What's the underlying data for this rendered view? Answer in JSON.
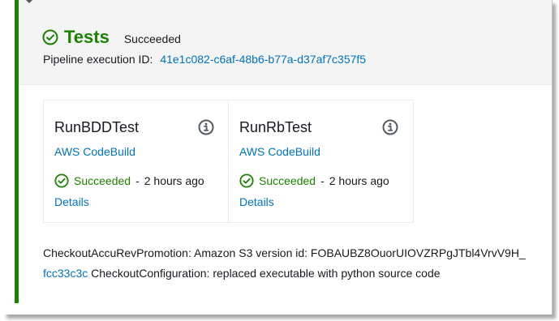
{
  "stage": {
    "title": "Tests",
    "status": "Succeeded",
    "execution_label": "Pipeline execution ID:",
    "execution_id": "41e1c082-c6af-48b6-b77a-d37af7c357f5"
  },
  "actions": [
    {
      "name": "RunBDDTest",
      "provider": "AWS CodeBuild",
      "status": "Succeeded",
      "separator": "-",
      "time": "2 hours ago",
      "details_label": "Details"
    },
    {
      "name": "RunRbTest",
      "provider": "AWS CodeBuild",
      "status": "Succeeded",
      "separator": "-",
      "time": "2 hours ago",
      "details_label": "Details"
    }
  ],
  "revisions": {
    "line1": "CheckoutAccuRevPromotion: Amazon S3 version id: FOBAUBZ8OuorUIOVZRPgJTbl4VrvV9H_",
    "commit_id": "fcc33c3c",
    "line2_text": "CheckoutConfiguration: replaced executable with python source code"
  },
  "colors": {
    "success": "#1d8102",
    "link": "#0073bb",
    "header_bg": "#f4f4f4"
  },
  "icons": {
    "stage_status": "check-circle-icon",
    "action_info": "info-icon",
    "action_status": "check-circle-icon"
  }
}
